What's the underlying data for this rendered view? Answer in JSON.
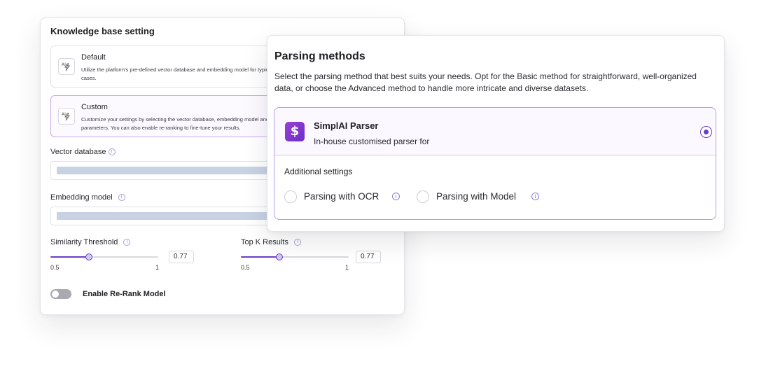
{
  "knowledge_base": {
    "title": "Knowledge base setting",
    "options": [
      {
        "title": "Default",
        "description": "Utilize the platform's pre-defined vector database and embedding model for typical use cases.",
        "selected": false,
        "icon": "ai-spark-icon"
      },
      {
        "title": "Custom",
        "description": "Customize your settings by selecting the vector database, embedding model and other parameters. You can also enable re-ranking to fine-tune your results.",
        "selected": true,
        "icon": "ai-spark-icon"
      }
    ],
    "vector_database": {
      "label": "Vector database"
    },
    "embedding_model": {
      "label": "Embedding model"
    },
    "similarity_threshold": {
      "label": "Similarity Threshold",
      "value": "0.77",
      "min": "0.5",
      "max": "1",
      "fill_fraction": 0.36
    },
    "top_k": {
      "label": "Top K Results",
      "value": "0.77",
      "min": "0.5",
      "max": "1",
      "fill_fraction": 0.36
    },
    "rerank": {
      "label": "Enable Re-Rank Model",
      "enabled": false
    }
  },
  "parsing": {
    "title": "Parsing methods",
    "description": "Select the parsing method that best suits your needs. Opt for the Basic method for straightforward, well-organized data, or choose the Advanced method to handle more intricate and diverse datasets.",
    "parser": {
      "name": "SimplAI Parser",
      "subtitle": "In-house customised parser for",
      "logo_glyph": "$",
      "selected": true
    },
    "additional_settings_label": "Additional settings",
    "options": [
      {
        "label": "Parsing with OCR",
        "checked": false
      },
      {
        "label": "Parsing with Model",
        "checked": false
      }
    ],
    "info_glyph": "i"
  },
  "colors": {
    "accent": "#6a3fc8",
    "selected_border": "#b79be8",
    "select_placeholder": "#c7d2e2"
  }
}
